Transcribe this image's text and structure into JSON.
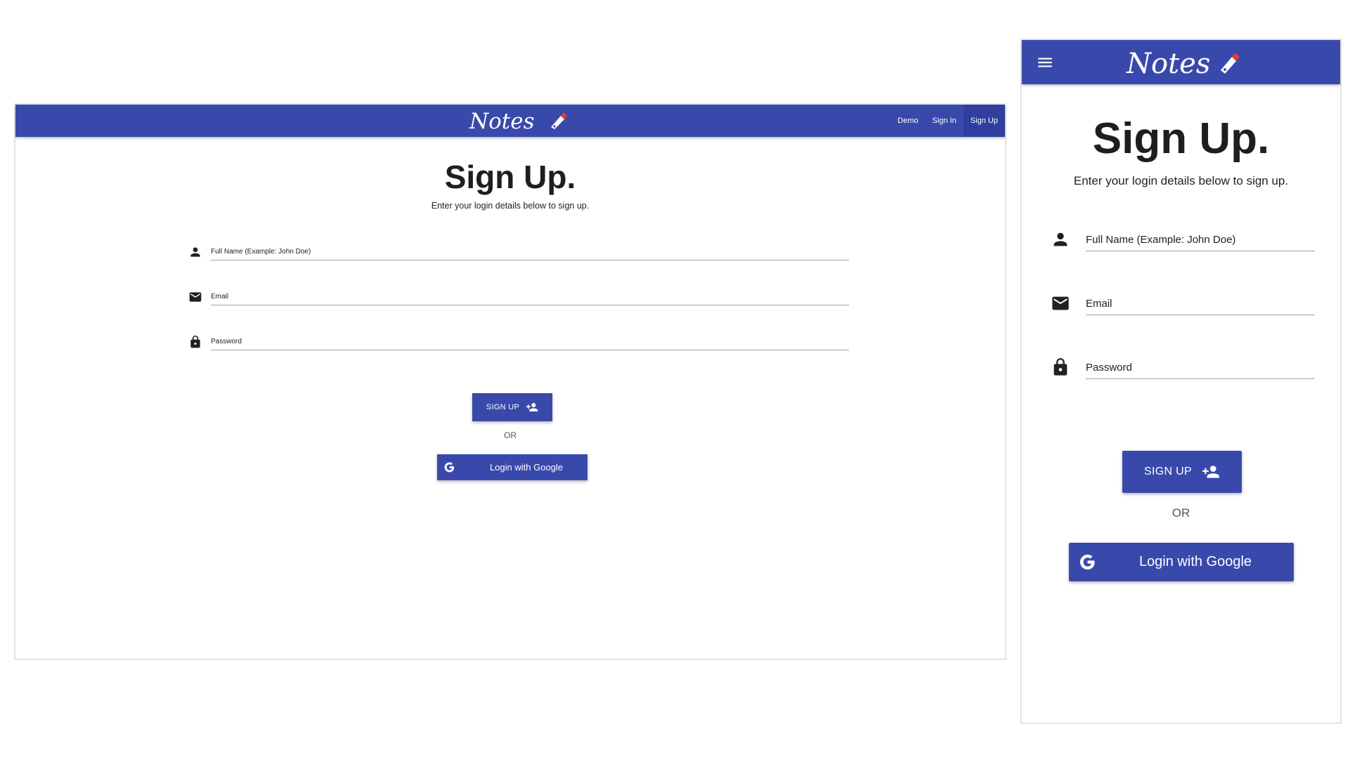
{
  "brand": {
    "logo_text": "Notes",
    "primary_color": "#3949ab",
    "active_nav_color": "#303f9f"
  },
  "nav": {
    "items": [
      "Demo",
      "Sign In",
      "Sign Up"
    ],
    "active": "Sign Up"
  },
  "page": {
    "title": "Sign Up.",
    "subtitle": "Enter your login details below to sign up."
  },
  "form": {
    "fields": [
      {
        "icon": "person-icon",
        "placeholder": "Full Name (Example: John Doe)"
      },
      {
        "icon": "mail-icon",
        "placeholder": "Email"
      },
      {
        "icon": "lock-icon",
        "placeholder": "Password"
      }
    ],
    "signup_label": "SIGN UP",
    "signup_icon": "person-add-icon",
    "or_text": "OR",
    "google_label": "Login with Google",
    "google_icon": "google-icon"
  },
  "mobile": {
    "menu_icon": "hamburger-menu-icon"
  }
}
